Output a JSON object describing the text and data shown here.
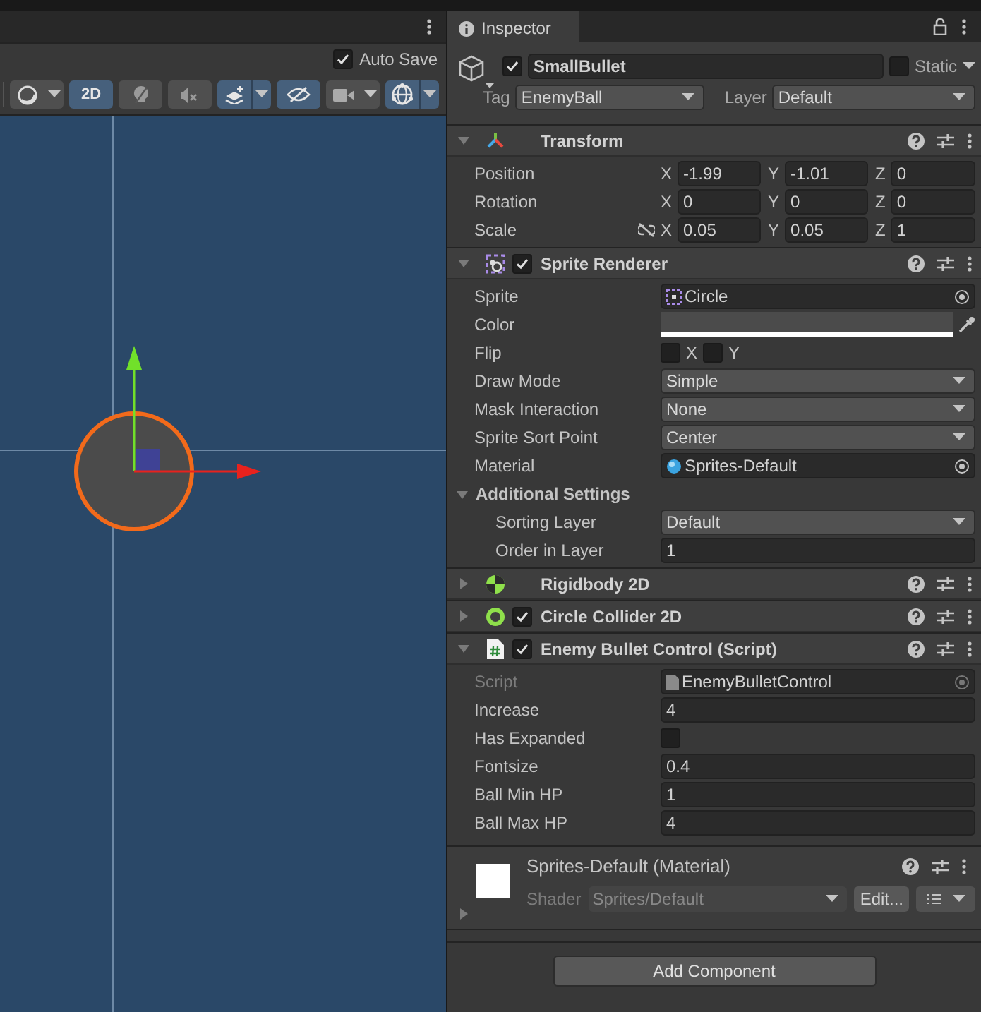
{
  "scene": {
    "auto_save": {
      "label": "Auto Save",
      "checked": true
    },
    "toolbar": [
      {
        "kind": "shading",
        "selected": false,
        "dropdown": true
      },
      {
        "kind": "text",
        "label": "2D",
        "selected": true,
        "dropdown": false
      },
      {
        "kind": "lighting",
        "selected": false,
        "dropdown": false
      },
      {
        "kind": "audio",
        "selected": false,
        "dropdown": false
      },
      {
        "kind": "effects",
        "selected": true,
        "dropdown": true
      },
      {
        "kind": "visibility",
        "selected": true,
        "dropdown": false
      },
      {
        "kind": "camera",
        "selected": false,
        "dropdown": true
      },
      {
        "kind": "gizmos",
        "selected": true,
        "dropdown": true
      }
    ]
  },
  "inspector": {
    "title": "Inspector",
    "object": {
      "active": true,
      "name": "SmallBullet",
      "static_label": "Static",
      "static": false,
      "tag_label": "Tag",
      "tag": "EnemyBall",
      "layer_label": "Layer",
      "layer": "Default"
    },
    "components": [
      {
        "kind": "transform",
        "title": "Transform",
        "expanded": true,
        "properties": [
          {
            "kind": "vector3",
            "label": "Position",
            "values": [
              {
                "axis": "X",
                "value": "-1.99"
              },
              {
                "axis": "Y",
                "value": "-1.01"
              },
              {
                "axis": "Z",
                "value": "0"
              }
            ]
          },
          {
            "kind": "vector3",
            "label": "Rotation",
            "values": [
              {
                "axis": "X",
                "value": "0"
              },
              {
                "axis": "Y",
                "value": "0"
              },
              {
                "axis": "Z",
                "value": "0"
              }
            ]
          },
          {
            "kind": "vector3",
            "label": "Scale",
            "proportional": false,
            "values": [
              {
                "axis": "X",
                "value": "0.05"
              },
              {
                "axis": "Y",
                "value": "0.05"
              },
              {
                "axis": "Z",
                "value": "1"
              }
            ]
          }
        ]
      },
      {
        "kind": "sprite_renderer",
        "title": "Sprite Renderer",
        "enabled": true,
        "expanded": true,
        "properties": [
          {
            "kind": "object",
            "label": "Sprite",
            "value": {
              "kind": "sprite",
              "text": "Circle"
            },
            "disabled": false
          },
          {
            "kind": "color",
            "label": "Color",
            "color": "#4b4b4b",
            "level": 1
          },
          {
            "kind": "flip",
            "label": "Flip",
            "options": [
              {
                "label": "X",
                "checked": false
              },
              {
                "label": "Y",
                "checked": false
              }
            ]
          },
          {
            "kind": "dropdown",
            "label": "Draw Mode",
            "value": "Simple"
          },
          {
            "kind": "dropdown",
            "label": "Mask Interaction",
            "value": "None"
          },
          {
            "kind": "dropdown",
            "label": "Sprite Sort Point",
            "value": "Center"
          },
          {
            "kind": "object",
            "label": "Material",
            "value": {
              "kind": "material",
              "text": "Sprites-Default"
            },
            "disabled": false
          },
          {
            "kind": "foldout",
            "label": "Additional Settings",
            "expanded": true,
            "children": [
              {
                "kind": "dropdown",
                "label": "Sorting Layer",
                "value": "Default"
              },
              {
                "kind": "number",
                "label": "Order in Layer",
                "value": "1"
              }
            ]
          }
        ]
      },
      {
        "kind": "rigidbody",
        "title": "Rigidbody 2D",
        "expanded": false
      },
      {
        "kind": "collider",
        "title": "Circle Collider 2D",
        "enabled": true,
        "expanded": false
      },
      {
        "kind": "script",
        "title": "Enemy Bullet Control (Script)",
        "enabled": true,
        "expanded": true,
        "properties": [
          {
            "kind": "object",
            "label": "Script",
            "value": {
              "kind": "script",
              "text": "EnemyBulletControl"
            },
            "disabled": true
          },
          {
            "kind": "number",
            "label": "Increase",
            "value": "4"
          },
          {
            "kind": "checkbox",
            "label": "Has Expanded",
            "checked": false
          },
          {
            "kind": "number",
            "label": "Fontsize",
            "value": "0.4"
          },
          {
            "kind": "number",
            "label": "Ball Min HP",
            "value": "1"
          },
          {
            "kind": "number",
            "label": "Ball Max HP",
            "value": "4"
          }
        ]
      }
    ],
    "material": {
      "title": "Sprites-Default (Material)",
      "expanded": false,
      "shader_label": "Shader",
      "shader": "Sprites/Default",
      "edit_button": "Edit..."
    },
    "add_component": "Add Component"
  }
}
